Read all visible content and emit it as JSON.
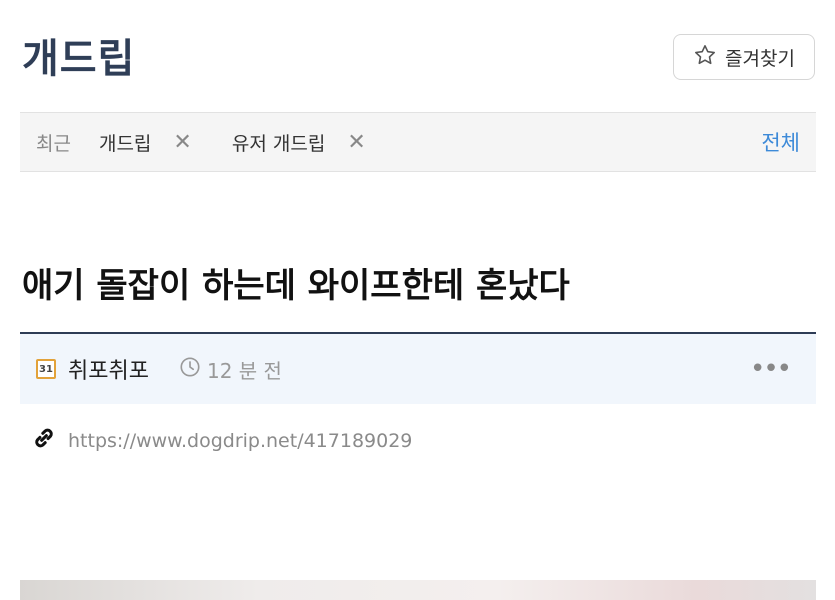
{
  "board": {
    "title": "개드립"
  },
  "favorite": {
    "label": "즐겨찾기",
    "icon": "star-outline-icon"
  },
  "recent": {
    "label": "최근",
    "chips": [
      {
        "label": "개드립",
        "remove_icon": "close-icon"
      },
      {
        "label": "유저 개드립",
        "remove_icon": "close-icon"
      }
    ],
    "view_all": "전체"
  },
  "post": {
    "title": "애기 돌잡이 하는데 와이프한테 혼났다",
    "level_badge": "31",
    "author": "취포취포",
    "time": "12 분 전",
    "more": "•••",
    "url": "https://www.dogdrip.net/417189029"
  },
  "colors": {
    "title": "#2f3e57",
    "accent_link": "#3d8ad8",
    "divider": "#2e3c55",
    "meta_bg": "#f1f6fc"
  }
}
